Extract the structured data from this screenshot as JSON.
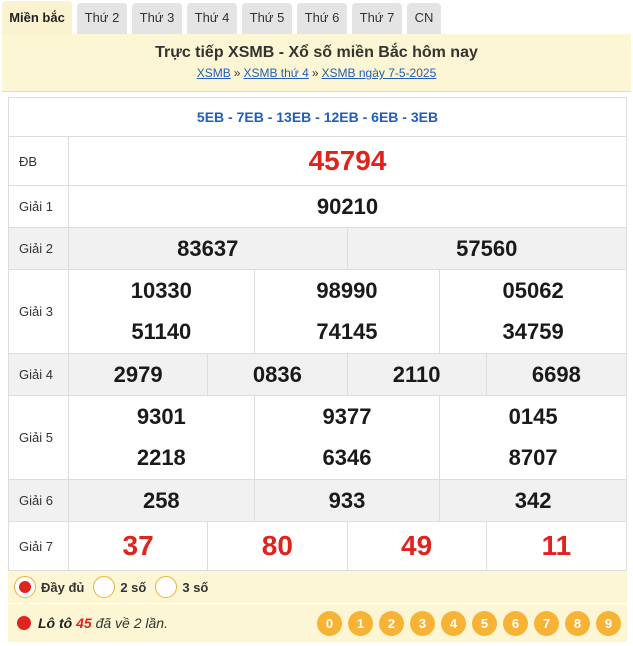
{
  "tabs": [
    "Miền bắc",
    "Thứ 2",
    "Thứ 3",
    "Thứ 4",
    "Thứ 5",
    "Thứ 6",
    "Thứ 7",
    "CN"
  ],
  "header": {
    "title": "Trực tiếp XSMB - Xổ số miền Bắc hôm nay",
    "crumbs": [
      "XSMB",
      "XSMB thứ 4",
      "XSMB ngày 7-5-2025"
    ],
    "separator": "»"
  },
  "codes": "5EB - 7EB - 13EB - 12EB - 6EB - 3EB",
  "prizes": {
    "db": {
      "label": "ĐB",
      "values": [
        "45794"
      ]
    },
    "g1": {
      "label": "Giải 1",
      "values": [
        "90210"
      ]
    },
    "g2": {
      "label": "Giải 2",
      "values": [
        "83637",
        "57560"
      ]
    },
    "g3": {
      "label": "Giải 3",
      "values": [
        "10330",
        "98990",
        "05062",
        "51140",
        "74145",
        "34759"
      ]
    },
    "g4": {
      "label": "Giải 4",
      "values": [
        "2979",
        "0836",
        "2110",
        "6698"
      ]
    },
    "g5": {
      "label": "Giải 5",
      "values": [
        "9301",
        "9377",
        "0145",
        "2218",
        "6346",
        "8707"
      ]
    },
    "g6": {
      "label": "Giải 6",
      "values": [
        "258",
        "933",
        "342"
      ]
    },
    "g7": {
      "label": "Giải 7",
      "values": [
        "37",
        "80",
        "49",
        "11"
      ]
    }
  },
  "options": [
    "Đầy đủ",
    "2 số",
    "3 số"
  ],
  "loto": {
    "prefix": "Lô tô",
    "number": "45",
    "suffix": "đã về 2 lần."
  },
  "digits": [
    "0",
    "1",
    "2",
    "3",
    "4",
    "5",
    "6",
    "7",
    "8",
    "9"
  ],
  "colors": {
    "prize_red": "#e0231d",
    "link_blue": "#1f5fb6",
    "digit_orange": "#f7b336",
    "header_bg": "#fdf6d4"
  }
}
